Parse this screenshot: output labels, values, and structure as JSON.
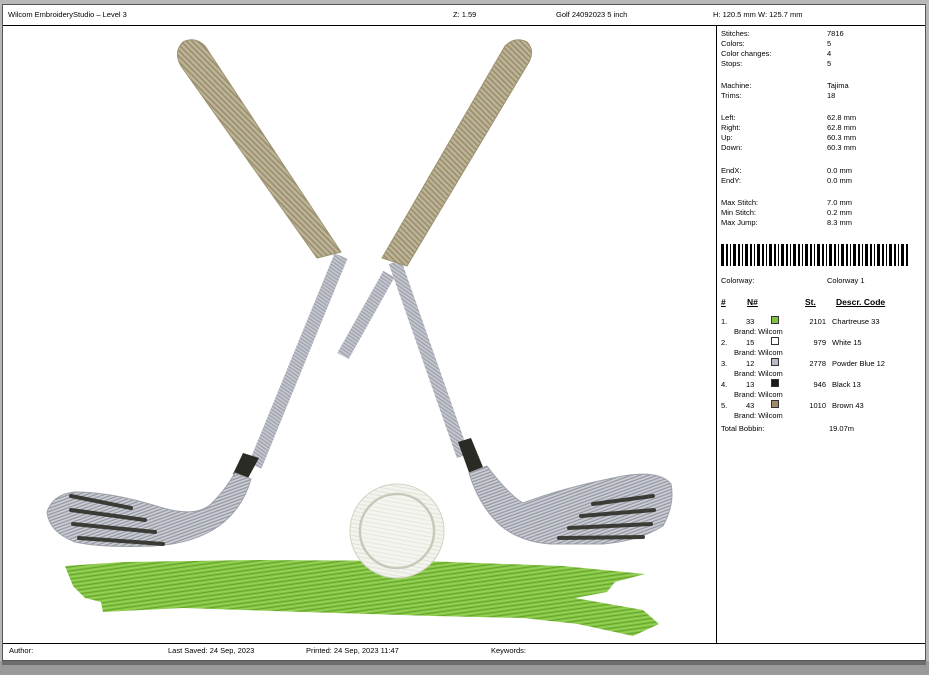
{
  "header": {
    "app_title": "Wilcom EmbroideryStudio – Level 3",
    "zoom": "Z: 1.59",
    "design_name": "Golf 24092023 5 inch",
    "dimensions": "H: 120.5 mm  W: 125.7 mm"
  },
  "stats": [
    {
      "label": "Stitches:",
      "value": "7816"
    },
    {
      "label": "Colors:",
      "value": "5"
    },
    {
      "label": "Color changes:",
      "value": "4"
    },
    {
      "label": "Stops:",
      "value": "5"
    },
    {
      "label": "Machine:",
      "value": "Tajima"
    },
    {
      "label": "Trims:",
      "value": "18"
    },
    {
      "label": "Left:",
      "value": "62.8 mm"
    },
    {
      "label": "Right:",
      "value": "62.8 mm"
    },
    {
      "label": "Up:",
      "value": "60.3 mm"
    },
    {
      "label": "Down:",
      "value": "60.3 mm"
    },
    {
      "label": "EndX:",
      "value": "0.0 mm"
    },
    {
      "label": "EndY:",
      "value": "0.0 mm"
    },
    {
      "label": "Max Stitch:",
      "value": "7.0 mm"
    },
    {
      "label": "Min Stitch:",
      "value": "0.2 mm"
    },
    {
      "label": "Max Jump:",
      "value": "8.3 mm"
    }
  ],
  "colorway": {
    "label": "Colorway:",
    "value": "Colorway 1"
  },
  "thread_table": {
    "headers": {
      "index": "#",
      "number": "N#",
      "stitches": "St.",
      "description": "Descr. Code"
    },
    "rows": [
      {
        "index": "1.",
        "number": "33",
        "color": "#7fc242",
        "stitches": "2101",
        "description": "Chartreuse 33",
        "brand": "Brand: Wilcom"
      },
      {
        "index": "2.",
        "number": "15",
        "color": "#ffffff",
        "stitches": "979",
        "description": "White 15",
        "brand": "Brand: Wilcom"
      },
      {
        "index": "3.",
        "number": "12",
        "color": "#b9bcc6",
        "stitches": "2778",
        "description": "Powder Blue 12",
        "brand": "Brand: Wilcom"
      },
      {
        "index": "4.",
        "number": "13",
        "color": "#1a1a1a",
        "stitches": "946",
        "description": "Black 13",
        "brand": "Brand: Wilcom"
      },
      {
        "index": "5.",
        "number": "43",
        "color": "#a08a6a",
        "stitches": "1010",
        "description": "Brown 43",
        "brand": "Brand: Wilcom"
      }
    ],
    "total_bobbin": {
      "label": "Total Bobbin:",
      "value": "19.07m"
    }
  },
  "footer": {
    "author": "Author:",
    "last_saved": "Last Saved: 24 Sep, 2023",
    "printed": "Printed: 24 Sep, 2023 11:47",
    "keywords": "Keywords:"
  },
  "colors": {
    "grass": "#7fc242",
    "grip": "#b3a889",
    "shaft": "#b9bcc6",
    "ferrule": "#2b2b26",
    "ball": "#f1f3ea",
    "grooves": "#3b3b35"
  }
}
